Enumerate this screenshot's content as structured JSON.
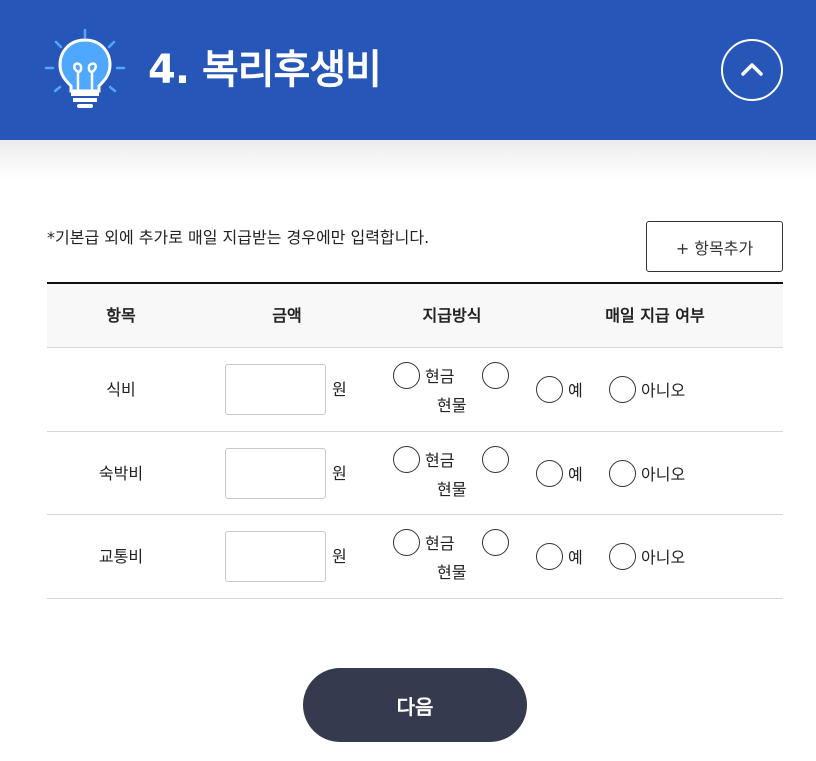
{
  "header": {
    "title": "4. 복리후생비",
    "icon": "lightbulb-icon",
    "collapse_icon": "chevron-up-icon",
    "bg_color": "#2657b8"
  },
  "note": "*기본급 외에 추가로 매일 지급받는 경우에만 입력합니다.",
  "add_button_label": "+ 항목추가",
  "table": {
    "headers": [
      "항목",
      "금액",
      "지급방식",
      "매일 지급 여부"
    ],
    "rows": [
      {
        "name": "식비",
        "amount": "",
        "unit": "원",
        "method_cash": "현금",
        "method_goods": "현물",
        "daily_yes": "예",
        "daily_no": "아니오"
      },
      {
        "name": "숙박비",
        "amount": "",
        "unit": "원",
        "method_cash": "현금",
        "method_goods": "현물",
        "daily_yes": "예",
        "daily_no": "아니오"
      },
      {
        "name": "교통비",
        "amount": "",
        "unit": "원",
        "method_cash": "현금",
        "method_goods": "현물",
        "daily_yes": "예",
        "daily_no": "아니오"
      }
    ]
  },
  "next_button_label": "다음",
  "colors": {
    "accent": "#2657b8",
    "next_button": "#353a4e"
  }
}
